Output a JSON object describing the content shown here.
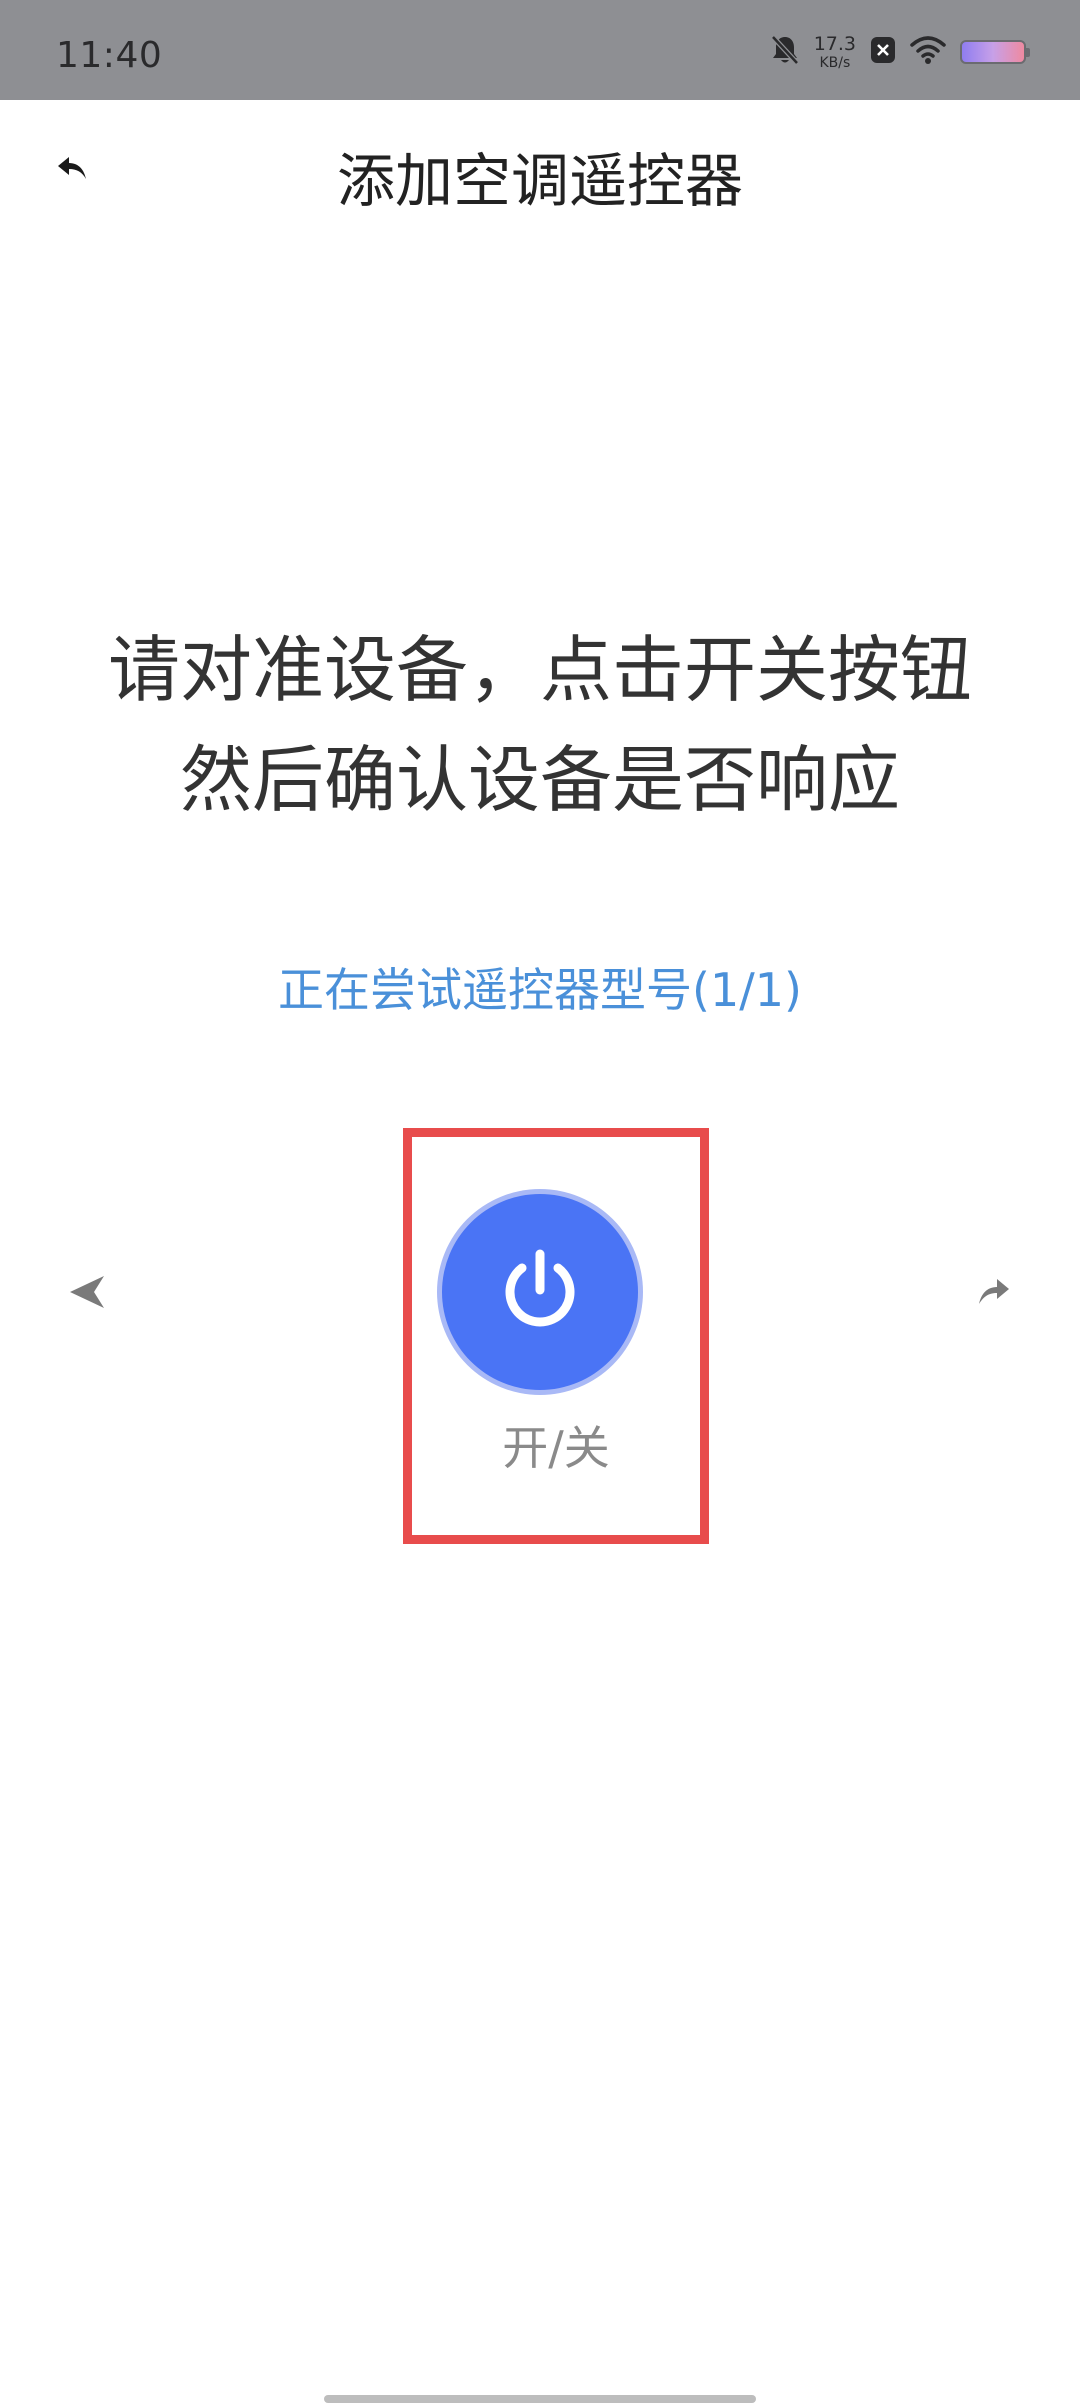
{
  "status_bar": {
    "time": "11:40",
    "net_speed_value": "17.3",
    "net_speed_unit": "KB/s",
    "icons": [
      "mute-bell-icon",
      "close-badge-icon",
      "wifi-icon",
      "battery-icon"
    ]
  },
  "header": {
    "title": "添加空调遥控器",
    "back_icon": "back-arrow-icon"
  },
  "instruction": {
    "line1": "请对准设备，点击开关按钮",
    "line2": "然后确认设备是否响应"
  },
  "model_status": "正在尝试遥控器型号(1/1)",
  "power": {
    "label": "开/关",
    "icon": "power-icon"
  },
  "navigation": {
    "prev_icon": "prev-arrow-icon",
    "next_icon": "next-arrow-icon"
  },
  "colors": {
    "accent_blue": "#4a74f5",
    "status_text_blue": "#4a90d9",
    "highlight_red": "#e84c4c",
    "status_bar_bg": "#8e8f93"
  }
}
